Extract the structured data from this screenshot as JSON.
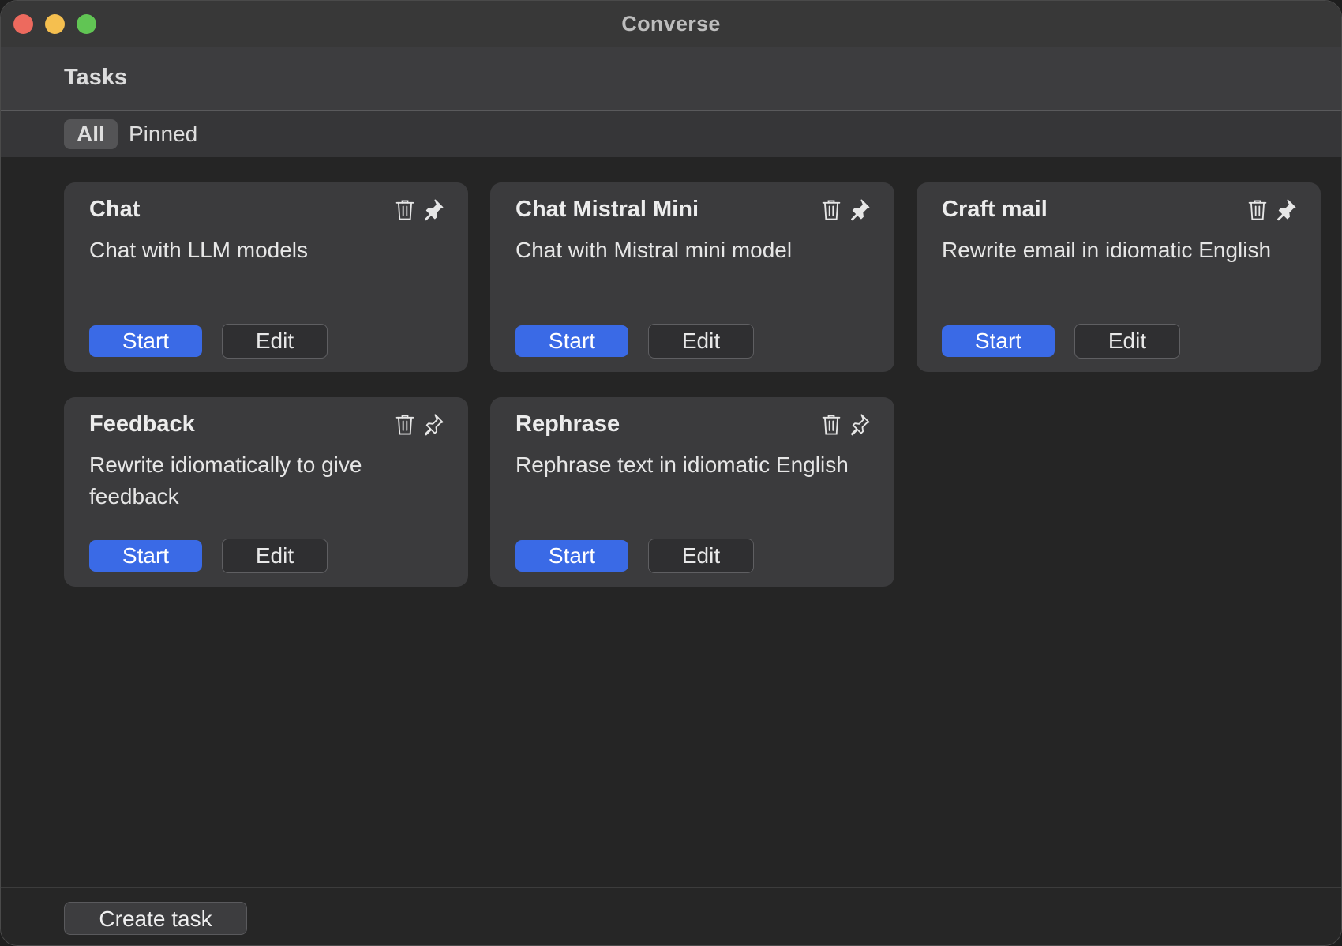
{
  "window": {
    "title": "Converse"
  },
  "header": {
    "title": "Tasks"
  },
  "tabs": [
    {
      "label": "All",
      "selected": true
    },
    {
      "label": "Pinned",
      "selected": false
    }
  ],
  "cards": [
    {
      "title": "Chat",
      "description": "Chat with LLM models",
      "pinned": true,
      "start_label": "Start",
      "edit_label": "Edit"
    },
    {
      "title": "Chat Mistral Mini",
      "description": "Chat with Mistral mini model",
      "pinned": true,
      "start_label": "Start",
      "edit_label": "Edit"
    },
    {
      "title": "Craft mail",
      "description": "Rewrite email in idiomatic English",
      "pinned": true,
      "start_label": "Start",
      "edit_label": "Edit"
    },
    {
      "title": "Feedback",
      "description": "Rewrite idiomatically to give feedback",
      "pinned": false,
      "start_label": "Start",
      "edit_label": "Edit"
    },
    {
      "title": "Rephrase",
      "description": "Rephrase text in idiomatic English",
      "pinned": false,
      "start_label": "Start",
      "edit_label": "Edit"
    }
  ],
  "footer": {
    "create_label": "Create task"
  },
  "icons": {
    "delete": "trash-icon",
    "pin_filled": "pin-filled-icon",
    "pin_outline": "pin-outline-icon"
  },
  "colors": {
    "accent": "#3a6ae6",
    "card_bg": "#3b3b3d",
    "window_bg": "#252525"
  }
}
